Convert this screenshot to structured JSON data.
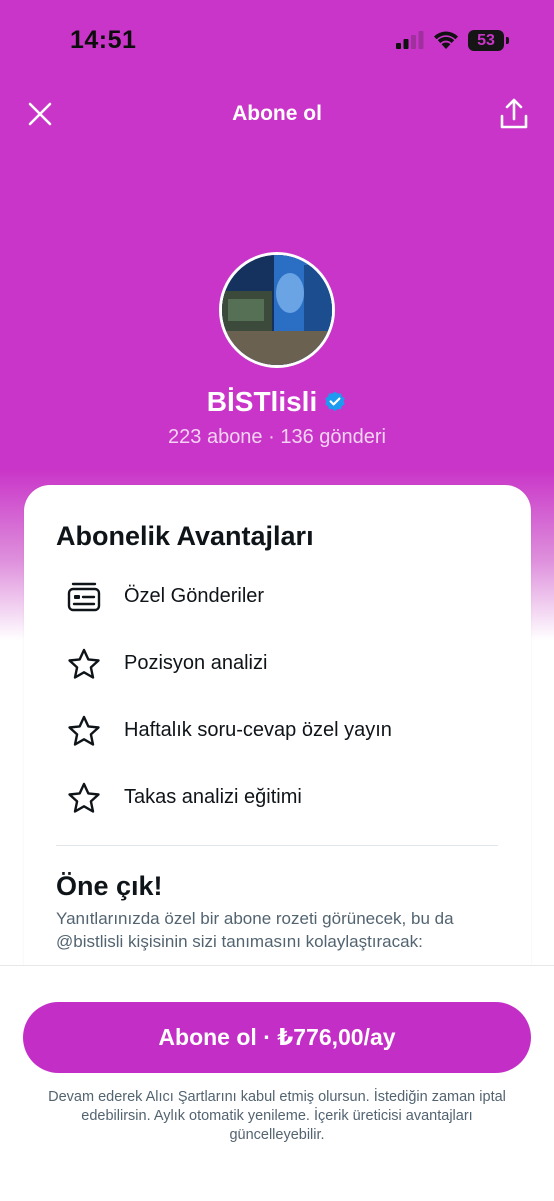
{
  "status_bar": {
    "time": "14:51",
    "battery_level": "53",
    "icons": [
      "cellular-signal-icon",
      "wifi-icon",
      "battery-icon"
    ]
  },
  "nav": {
    "title": "Abone ol",
    "close_icon": "close-icon",
    "share_icon": "share-icon"
  },
  "profile": {
    "name": "BİSTlisli",
    "verified": true,
    "stats": "223 abone · 136 gönderi"
  },
  "benefits_card": {
    "title": "Abonelik Avantajları",
    "items": [
      {
        "label": "Özel Gönderiler",
        "icon": "exclusive-posts-icon"
      },
      {
        "label": "Pozisyon analizi",
        "icon": "star-icon"
      },
      {
        "label": "Haftalık soru-cevap özel yayın",
        "icon": "star-icon"
      },
      {
        "label": "Takas analizi eğitimi",
        "icon": "star-icon"
      }
    ],
    "promo_title": "Öne çık!",
    "promo_desc": "Yanıtlarınızda özel bir abone rozeti görünecek, bu da @bistlisli kişisinin sizi tanımasını kolaylaştıracak:"
  },
  "footer": {
    "cta_label": "Abone ol · ₺776,00/ay",
    "legal": "Devam ederek Alıcı Şartlarını kabul etmiş olursun. İstediğin zaman iptal edebilirsin. Aylık otomatik yenileme. İçerik üreticisi avantajları güncelleyebilir."
  },
  "colors": {
    "brand_magenta": "#c935c8",
    "cta_magenta": "#c32fc6",
    "verified_blue": "#1d9bf0"
  }
}
